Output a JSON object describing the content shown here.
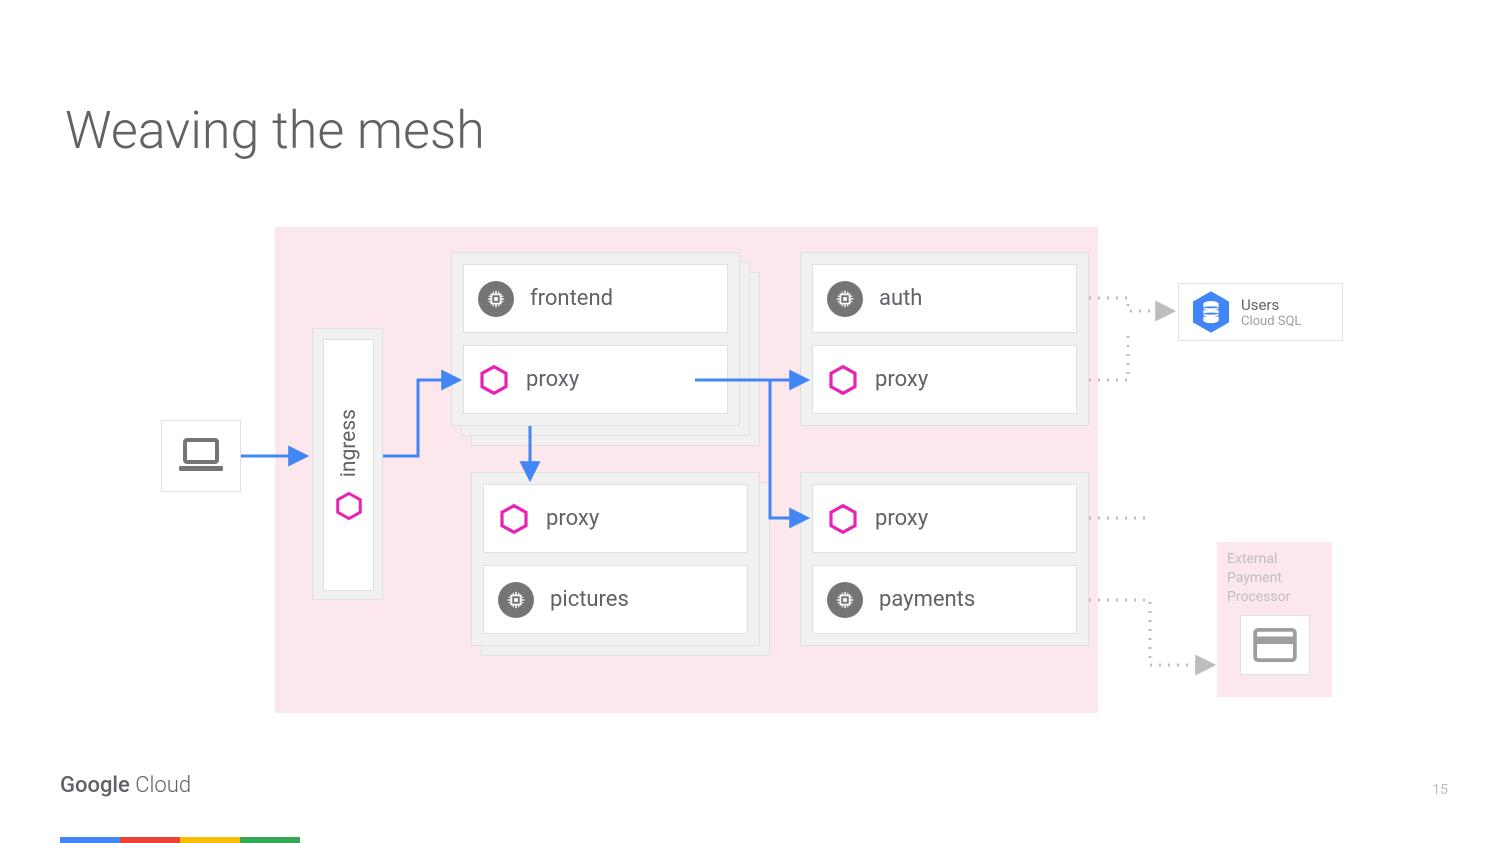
{
  "title": "Weaving the mesh",
  "ingress": {
    "label": "ingress"
  },
  "pods": {
    "frontend": {
      "service": "frontend",
      "proxy": "proxy"
    },
    "pictures": {
      "service": "pictures",
      "proxy": "proxy"
    },
    "auth": {
      "service": "auth",
      "proxy": "proxy"
    },
    "payments": {
      "service": "payments",
      "proxy": "proxy"
    }
  },
  "externals": {
    "users": {
      "title": "Users",
      "subtitle": "Cloud SQL"
    },
    "payproc": {
      "line1": "External",
      "line2": "Payment",
      "line3": "Processor"
    }
  },
  "footer": {
    "brand_bold": "Google",
    "brand_light": " Cloud",
    "page": "15"
  },
  "colors": {
    "mesh_bg": "#fce8ec",
    "arrow_blue": "#4285f4",
    "dotted_grey": "#bdbdbd",
    "hex_magenta": "#e822b5",
    "chip_grey": "#757575",
    "blue_db": "#4285f4"
  }
}
